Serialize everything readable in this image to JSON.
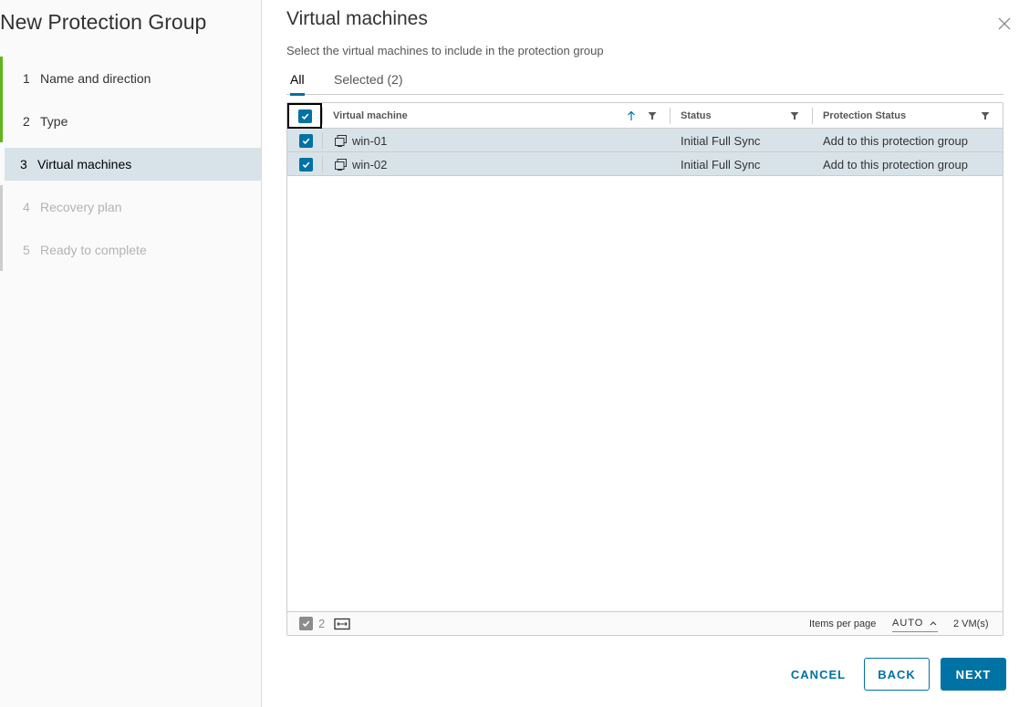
{
  "wizard": {
    "title": "New Protection Group",
    "steps": [
      {
        "num": "1",
        "label": "Name and direction"
      },
      {
        "num": "2",
        "label": "Type"
      },
      {
        "num": "3",
        "label": "Virtual machines"
      },
      {
        "num": "4",
        "label": "Recovery plan"
      },
      {
        "num": "5",
        "label": "Ready to complete"
      }
    ]
  },
  "page": {
    "title": "Virtual machines",
    "subtitle": "Select the virtual machines to include in the protection group"
  },
  "tabs": {
    "all": "All",
    "selected": "Selected (2)"
  },
  "grid": {
    "columns": {
      "vm": "Virtual machine",
      "status": "Status",
      "protection": "Protection Status"
    },
    "rows": [
      {
        "vm": "win-01",
        "status": "Initial Full Sync",
        "protection": "Add to this protection group"
      },
      {
        "vm": "win-02",
        "status": "Initial Full Sync",
        "protection": "Add to this protection group"
      }
    ],
    "footer": {
      "selected_count": "2",
      "items_per_page_label": "Items per page",
      "items_per_page_value": "AUTO",
      "total": "2 VM(s)"
    }
  },
  "buttons": {
    "cancel": "CANCEL",
    "back": "BACK",
    "next": "NEXT"
  },
  "colors": {
    "accent": "#0072a3",
    "step_done": "#5eb715",
    "selected_row": "#d8e3e9"
  }
}
